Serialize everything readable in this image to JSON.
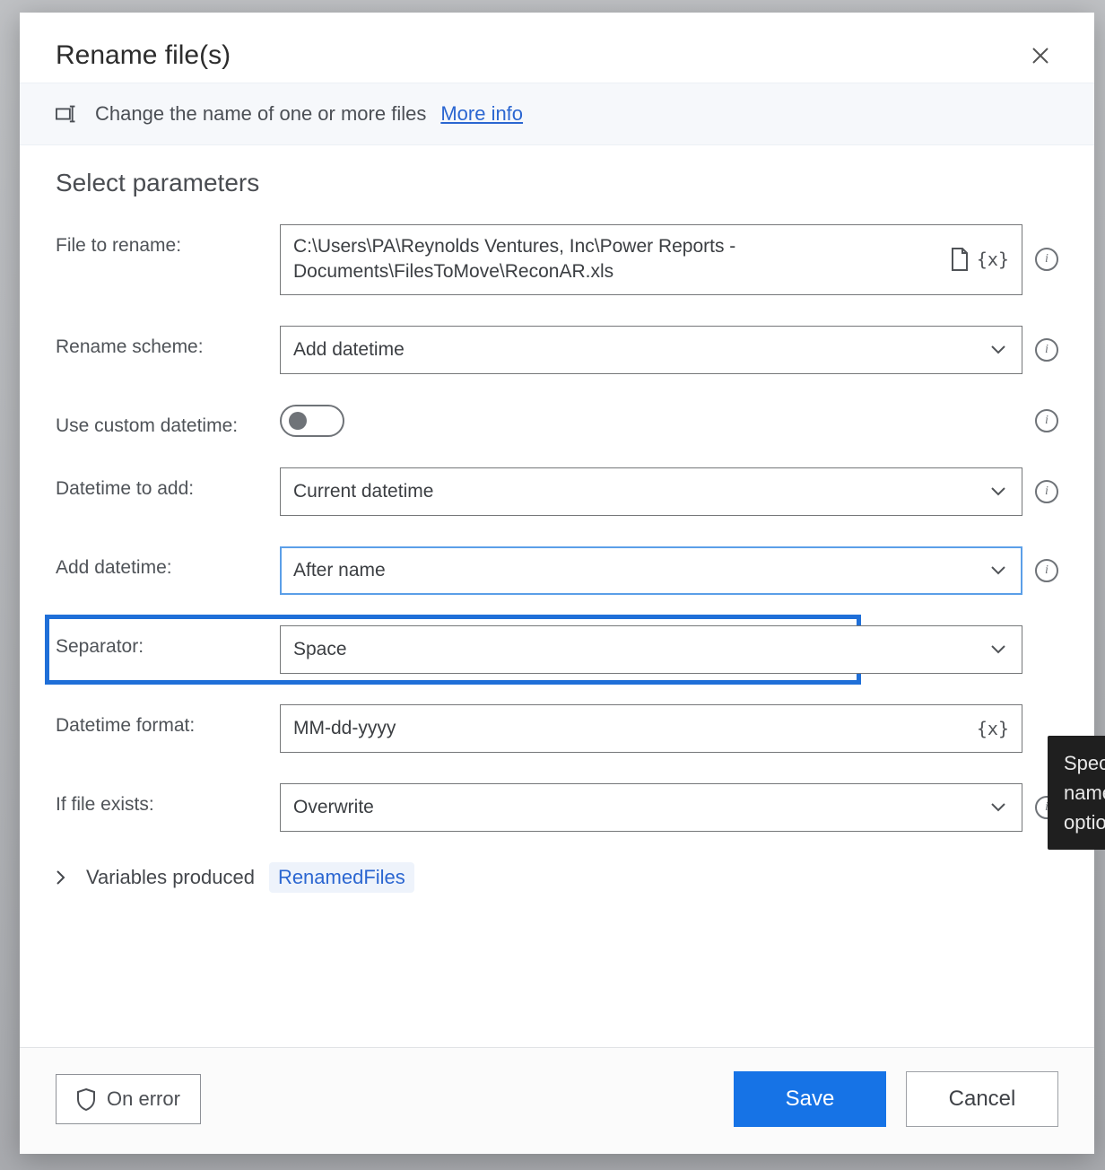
{
  "dialog": {
    "title": "Rename file(s)",
    "infobar": {
      "text": "Change the name of one or more files",
      "link": "More info"
    },
    "section_title": "Select parameters",
    "rows": {
      "file_to_rename": {
        "label": "File to rename:",
        "value": "C:\\Users\\PA\\Reynolds Ventures, Inc\\Power Reports - Documents\\FilesToMove\\ReconAR.xls"
      },
      "rename_scheme": {
        "label": "Rename scheme:",
        "value": "Add datetime"
      },
      "use_custom_dt": {
        "label": "Use custom datetime:",
        "value": false
      },
      "datetime_to_add": {
        "label": "Datetime to add:",
        "value": "Current datetime"
      },
      "add_datetime": {
        "label": "Add datetime:",
        "value": "After name"
      },
      "separator": {
        "label": "Separator:",
        "value": "Space"
      },
      "datetime_format": {
        "label": "Datetime format:",
        "value": "MM-dd-yyyy"
      },
      "if_file_exists": {
        "label": "If file exists:",
        "value": "Overwrite"
      }
    },
    "variables": {
      "label": "Variables produced",
      "value": "RenamedFiles"
    },
    "footer": {
      "on_error": "On error",
      "save": "Save",
      "cancel": "Cancel"
    },
    "tooltip": "Specif\nname \noption"
  }
}
